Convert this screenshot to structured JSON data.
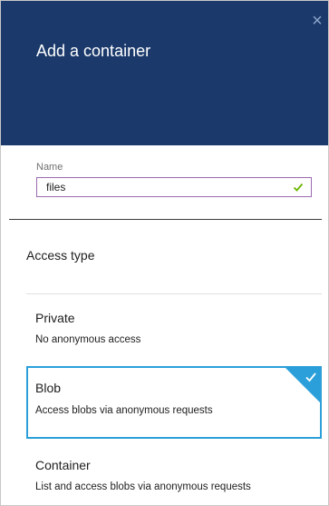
{
  "blade": {
    "title": "Add a container",
    "close_glyph": "×",
    "header_color": "#1b3a6b"
  },
  "form": {
    "name_label": "Name",
    "name_value": "files",
    "name_valid_icon": "checkmark-icon",
    "valid_color": "#6bb700"
  },
  "access": {
    "section_title": "Access type",
    "selected": "Blob",
    "accent_color": "#2b9fd9",
    "options": [
      {
        "title": "Private",
        "description": "No anonymous access"
      },
      {
        "title": "Blob",
        "description": "Access blobs via anonymous requests"
      },
      {
        "title": "Container",
        "description": "List and access blobs via anonymous requests"
      }
    ]
  }
}
